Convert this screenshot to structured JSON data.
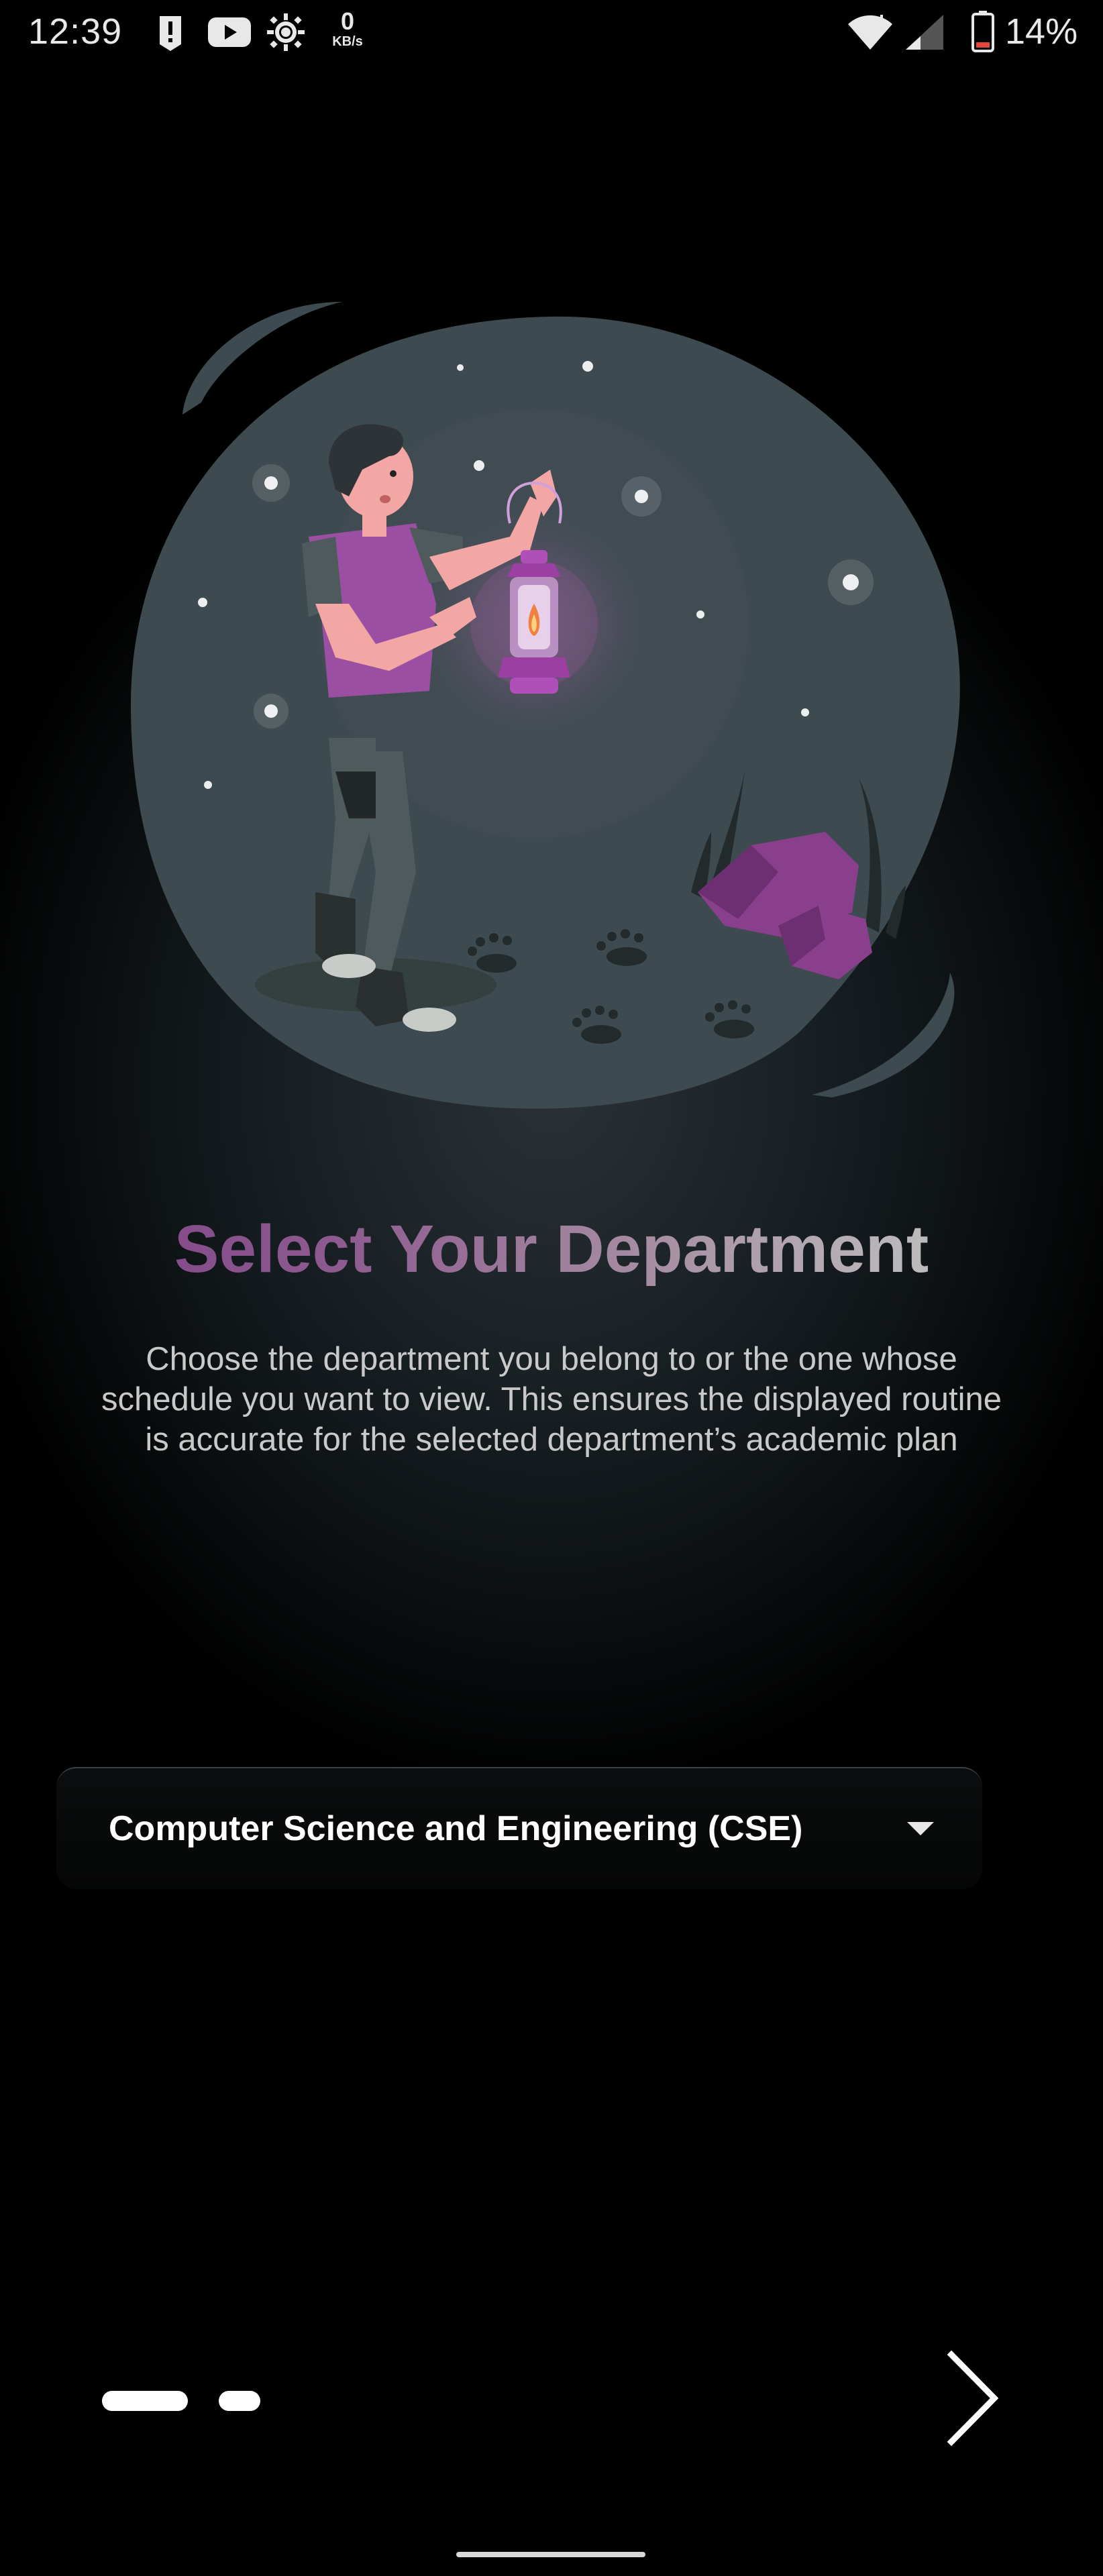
{
  "status_bar": {
    "time": "12:39",
    "icons": [
      "alert-icon",
      "youtube-icon",
      "brightness-icon"
    ],
    "network_speed_value": "0",
    "network_speed_unit": "KB/s",
    "right_icons": [
      "wifi-icon",
      "cell-signal-icon",
      "battery-icon"
    ],
    "battery_percent": "14%",
    "battery_level": 0.14
  },
  "onboarding": {
    "illustration": "man-with-lantern-illustration",
    "title": "Select Your Department",
    "description": "Choose the department you belong to or the one whose schedule you want to view. This ensures the displayed routine is accurate for the selected department’s academic plan"
  },
  "department_select": {
    "selected_value": "Computer Science and Engineering (CSE)",
    "icon": "caret-down-icon"
  },
  "pager": {
    "page_count": 2,
    "current_page": 1,
    "next_icon": "chevron-right-icon"
  },
  "colors": {
    "background": "#000000",
    "title_gradient_start": "#7b3f86",
    "title_gradient_end": "#c8c8c8",
    "accent_purple": "#9b4fa3",
    "illustration_blob": "#3d4a4f"
  }
}
